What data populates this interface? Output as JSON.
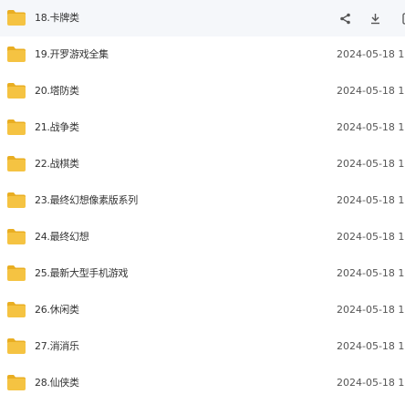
{
  "files": [
    {
      "name": "18.卡牌类",
      "date": ""
    },
    {
      "name": "19.开罗游戏全集",
      "date": "2024-05-18 1"
    },
    {
      "name": "20.塔防类",
      "date": "2024-05-18 1"
    },
    {
      "name": "21.战争类",
      "date": "2024-05-18 1"
    },
    {
      "name": "22.战棋类",
      "date": "2024-05-18 1"
    },
    {
      "name": "23.最终幻想像素版系列",
      "date": "2024-05-18 1"
    },
    {
      "name": "24.最终幻想",
      "date": "2024-05-18 1"
    },
    {
      "name": "25.最新大型手机游戏",
      "date": "2024-05-18 1"
    },
    {
      "name": "26.休闲类",
      "date": "2024-05-18 1"
    },
    {
      "name": "27.消消乐",
      "date": "2024-05-18 1"
    },
    {
      "name": "28.仙侠类",
      "date": "2024-05-18 1"
    }
  ],
  "hover_actions": [
    "share-icon",
    "download-icon",
    "more-icon"
  ],
  "colors": {
    "folder": "#f5c342",
    "folder_tab": "#e9ae22",
    "hover_bg": "#f5f7fa",
    "icon": "#555555"
  }
}
